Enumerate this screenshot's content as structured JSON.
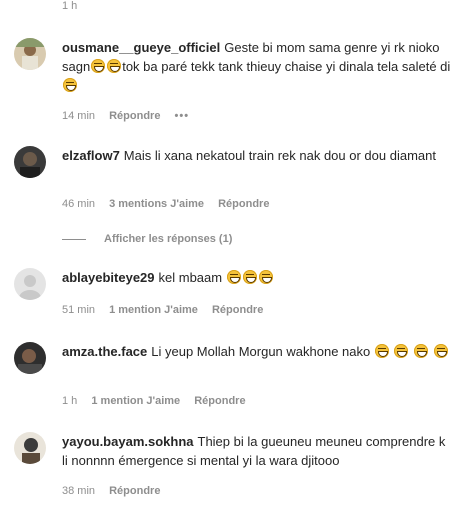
{
  "top_meta": "1 h",
  "comments": [
    {
      "username": "ousmane__gueye_officiel",
      "text_parts": [
        "Geste bi mom sama genre yi rk nioko sagn",
        "",
        "",
        "tok ba paré tekk tank thieuy chaise yi dinala tela saleté di",
        ""
      ],
      "time": "14 min",
      "reply_label": "Répondre",
      "more": "•••",
      "avatar_colors": [
        "#8a9a6b",
        "#d9cbb0"
      ]
    },
    {
      "username": "elzaflow7",
      "text": "Mais li xana nekatoul train rek nak dou or dou diamant",
      "time": "46 min",
      "likes": "3 mentions J'aime",
      "reply_label": "Répondre",
      "show_replies": "Afficher les réponses (1)",
      "avatar_colors": [
        "#3a3a3a",
        "#6b5a4a"
      ]
    },
    {
      "username": "ablayebiteye29",
      "text": "kel mbaam",
      "emoji_count": 3,
      "time": "51 min",
      "likes": "1 mention J'aime",
      "reply_label": "Répondre",
      "avatar_colors": [
        "#c9c9c9",
        "#e4e4e4"
      ]
    },
    {
      "username": "amza.the.face",
      "text": "Li yeup Mollah Morgun wakhone nako",
      "emoji_count": 4,
      "time": "1 h",
      "likes": "1 mention J'aime",
      "reply_label": "Répondre",
      "avatar_colors": [
        "#2e2e2e",
        "#7a5c48"
      ]
    },
    {
      "username": "yayou.bayam.sokhna",
      "text": "Thiep bi la gueuneu meuneu comprendre k li nonnnn émergence si mental yi la wara djitooo",
      "time": "38 min",
      "reply_label": "Répondre",
      "avatar_colors": [
        "#e9e4da",
        "#3b3b3b"
      ]
    }
  ],
  "colors": {
    "text": "#262626",
    "muted": "#8e8e8e",
    "emoji": "#f5c33b"
  }
}
